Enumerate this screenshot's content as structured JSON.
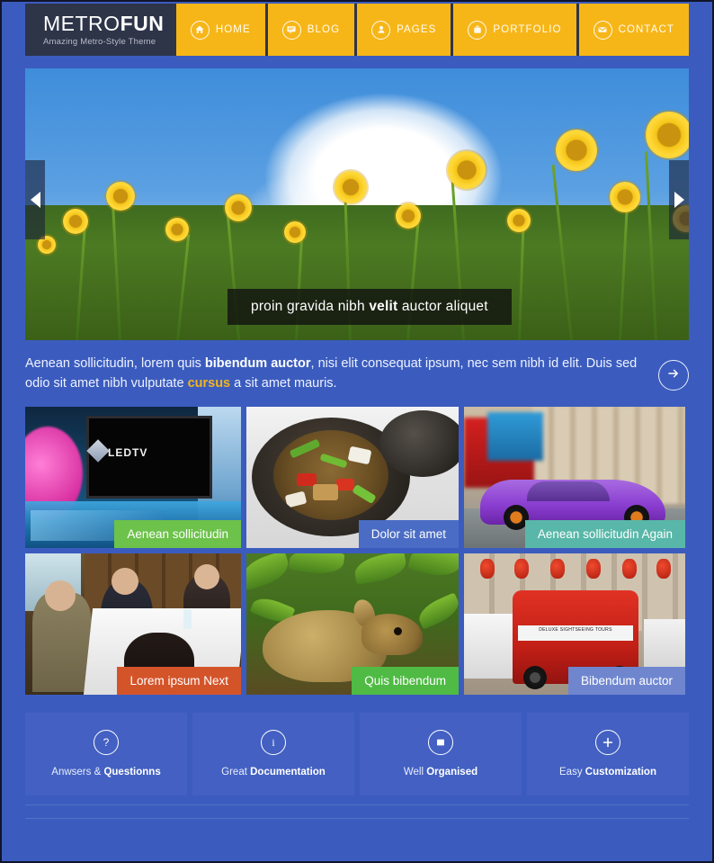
{
  "header": {
    "brand_prefix": "METRO",
    "brand_suffix": "FUN",
    "tagline": "Amazing Metro-Style Theme",
    "nav": [
      {
        "label": "HOME",
        "icon": "home-icon"
      },
      {
        "label": "BLOG",
        "icon": "chat-screen-icon"
      },
      {
        "label": "PAGES",
        "icon": "person-icon"
      },
      {
        "label": "PORTFOLIO",
        "icon": "bag-icon"
      },
      {
        "label": "CONTACT",
        "icon": "envelope-icon"
      }
    ]
  },
  "slider": {
    "caption_before": "proin gravida nibh ",
    "caption_bold": "velit",
    "caption_after": " auctor aliquet",
    "prev_label": "◀",
    "next_label": "▶",
    "image_alt": "yellow helenium flowers against blue sky with white cloud"
  },
  "intro": {
    "part1": "Aenean sollicitudin, lorem quis ",
    "bold1": "bibendum auctor",
    "part2": ", nisi elit consequat ipsum, nec sem nibh id elit. Duis sed odio sit amet nibh vulputate ",
    "highlight": "cursus",
    "part3": " a sit amet mauris.",
    "button_icon": "arrow-right-circle-icon"
  },
  "tiles": [
    {
      "caption": "Aenean sollicitudin",
      "color": "#6cc24a",
      "art": "led-tv-showroom"
    },
    {
      "caption": "Dolor sit amet",
      "color": "#4a6cc4",
      "art": "clay-pot-food"
    },
    {
      "caption": "Aenean sollicitudin Again",
      "color": "#58b7a8",
      "art": "purple-supercar"
    },
    {
      "caption": "Lorem ipsum Next",
      "color": "#d4542a",
      "art": "business-meeting"
    },
    {
      "caption": "Quis bibendum",
      "color": "#4fbb44",
      "art": "deer-in-foliage"
    },
    {
      "caption": "Bibendum auctor",
      "color": "#6f86cf",
      "art": "red-double-decker-bus"
    }
  ],
  "bus_sign": "DELUXE SIGHTSEEING TOURS",
  "tv_logo": "LEDTV",
  "features": [
    {
      "light": "Anwsers & ",
      "bold": "Questionns",
      "icon": "question-mark-icon"
    },
    {
      "light": "Great ",
      "bold": "Documentation",
      "icon": "info-icon"
    },
    {
      "light": "Well ",
      "bold": "Organised",
      "icon": "window-icon"
    },
    {
      "light": "Easy ",
      "bold": "Customization",
      "icon": "plus-icon"
    }
  ],
  "colors": {
    "page_background": "#3b5cbe",
    "header_background": "#2e3549",
    "nav_accent": "#f7b618",
    "feature_tile": "#4360c2",
    "highlight_text": "#f4b51d"
  }
}
